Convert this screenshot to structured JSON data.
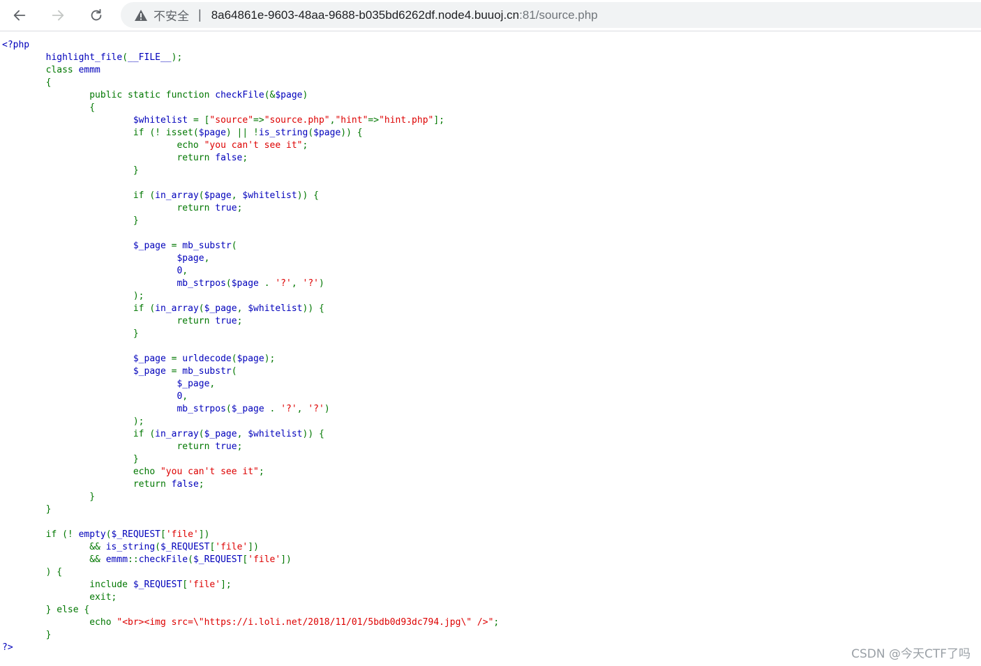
{
  "browser": {
    "insecure_label": "不安全",
    "separator": "|",
    "url_host": "8a64861e-9603-48aa-9688-b035bd6262df.node4.buuoj.cn",
    "url_rest": ":81/source.php"
  },
  "watermark": "CSDN @今天CTF了吗",
  "code_lines": [
    [
      [
        "d",
        "<?php"
      ]
    ],
    [
      [
        "d",
        "        highlight_file"
      ],
      [
        "k",
        "("
      ],
      [
        "d",
        "__FILE__"
      ],
      [
        "k",
        ");"
      ]
    ],
    [
      [
        "k",
        "        class "
      ],
      [
        "d",
        "emmm"
      ]
    ],
    [
      [
        "k",
        "        {"
      ]
    ],
    [
      [
        "k",
        "                public static function "
      ],
      [
        "d",
        "checkFile"
      ],
      [
        "k",
        "(&"
      ],
      [
        "d",
        "$page"
      ],
      [
        "k",
        ")"
      ]
    ],
    [
      [
        "k",
        "                {"
      ]
    ],
    [
      [
        "d",
        "                        $whitelist "
      ],
      [
        "k",
        "= ["
      ],
      [
        "s",
        "\"source\""
      ],
      [
        "k",
        "=>"
      ],
      [
        "s",
        "\"source.php\""
      ],
      [
        "k",
        ","
      ],
      [
        "s",
        "\"hint\""
      ],
      [
        "k",
        "=>"
      ],
      [
        "s",
        "\"hint.php\""
      ],
      [
        "k",
        "];"
      ]
    ],
    [
      [
        "k",
        "                        if (! isset("
      ],
      [
        "d",
        "$page"
      ],
      [
        "k",
        ") || !"
      ],
      [
        "d",
        "is_string"
      ],
      [
        "k",
        "("
      ],
      [
        "d",
        "$page"
      ],
      [
        "k",
        ")) {"
      ]
    ],
    [
      [
        "k",
        "                                echo "
      ],
      [
        "s",
        "\"you can't see it\""
      ],
      [
        "k",
        ";"
      ]
    ],
    [
      [
        "k",
        "                                return "
      ],
      [
        "d",
        "false"
      ],
      [
        "k",
        ";"
      ]
    ],
    [
      [
        "k",
        "                        }"
      ]
    ],
    [
      [
        "d",
        ""
      ]
    ],
    [
      [
        "k",
        "                        if ("
      ],
      [
        "d",
        "in_array"
      ],
      [
        "k",
        "("
      ],
      [
        "d",
        "$page"
      ],
      [
        "k",
        ", "
      ],
      [
        "d",
        "$whitelist"
      ],
      [
        "k",
        ")) {"
      ]
    ],
    [
      [
        "k",
        "                                return "
      ],
      [
        "d",
        "true"
      ],
      [
        "k",
        ";"
      ]
    ],
    [
      [
        "k",
        "                        }"
      ]
    ],
    [
      [
        "d",
        ""
      ]
    ],
    [
      [
        "d",
        "                        $_page "
      ],
      [
        "k",
        "= "
      ],
      [
        "d",
        "mb_substr"
      ],
      [
        "k",
        "("
      ]
    ],
    [
      [
        "d",
        "                                $page"
      ],
      [
        "k",
        ","
      ]
    ],
    [
      [
        "d",
        "                                0"
      ],
      [
        "k",
        ","
      ]
    ],
    [
      [
        "d",
        "                                mb_strpos"
      ],
      [
        "k",
        "("
      ],
      [
        "d",
        "$page "
      ],
      [
        "k",
        ". "
      ],
      [
        "s",
        "'?'"
      ],
      [
        "k",
        ", "
      ],
      [
        "s",
        "'?'"
      ],
      [
        "k",
        ")"
      ]
    ],
    [
      [
        "k",
        "                        );"
      ]
    ],
    [
      [
        "k",
        "                        if ("
      ],
      [
        "d",
        "in_array"
      ],
      [
        "k",
        "("
      ],
      [
        "d",
        "$_page"
      ],
      [
        "k",
        ", "
      ],
      [
        "d",
        "$whitelist"
      ],
      [
        "k",
        ")) {"
      ]
    ],
    [
      [
        "k",
        "                                return "
      ],
      [
        "d",
        "true"
      ],
      [
        "k",
        ";"
      ]
    ],
    [
      [
        "k",
        "                        }"
      ]
    ],
    [
      [
        "d",
        ""
      ]
    ],
    [
      [
        "d",
        "                        $_page "
      ],
      [
        "k",
        "= "
      ],
      [
        "d",
        "urldecode"
      ],
      [
        "k",
        "("
      ],
      [
        "d",
        "$page"
      ],
      [
        "k",
        ");"
      ]
    ],
    [
      [
        "d",
        "                        $_page "
      ],
      [
        "k",
        "= "
      ],
      [
        "d",
        "mb_substr"
      ],
      [
        "k",
        "("
      ]
    ],
    [
      [
        "d",
        "                                $_page"
      ],
      [
        "k",
        ","
      ]
    ],
    [
      [
        "d",
        "                                0"
      ],
      [
        "k",
        ","
      ]
    ],
    [
      [
        "d",
        "                                mb_strpos"
      ],
      [
        "k",
        "("
      ],
      [
        "d",
        "$_page "
      ],
      [
        "k",
        ". "
      ],
      [
        "s",
        "'?'"
      ],
      [
        "k",
        ", "
      ],
      [
        "s",
        "'?'"
      ],
      [
        "k",
        ")"
      ]
    ],
    [
      [
        "k",
        "                        );"
      ]
    ],
    [
      [
        "k",
        "                        if ("
      ],
      [
        "d",
        "in_array"
      ],
      [
        "k",
        "("
      ],
      [
        "d",
        "$_page"
      ],
      [
        "k",
        ", "
      ],
      [
        "d",
        "$whitelist"
      ],
      [
        "k",
        ")) {"
      ]
    ],
    [
      [
        "k",
        "                                return "
      ],
      [
        "d",
        "true"
      ],
      [
        "k",
        ";"
      ]
    ],
    [
      [
        "k",
        "                        }"
      ]
    ],
    [
      [
        "k",
        "                        echo "
      ],
      [
        "s",
        "\"you can't see it\""
      ],
      [
        "k",
        ";"
      ]
    ],
    [
      [
        "k",
        "                        return "
      ],
      [
        "d",
        "false"
      ],
      [
        "k",
        ";"
      ]
    ],
    [
      [
        "k",
        "                }"
      ]
    ],
    [
      [
        "k",
        "        }"
      ]
    ],
    [
      [
        "d",
        ""
      ]
    ],
    [
      [
        "k",
        "        if (! "
      ],
      [
        "d",
        "empty"
      ],
      [
        "k",
        "("
      ],
      [
        "d",
        "$_REQUEST"
      ],
      [
        "k",
        "["
      ],
      [
        "s",
        "'file'"
      ],
      [
        "k",
        "])"
      ]
    ],
    [
      [
        "k",
        "                && "
      ],
      [
        "d",
        "is_string"
      ],
      [
        "k",
        "("
      ],
      [
        "d",
        "$_REQUEST"
      ],
      [
        "k",
        "["
      ],
      [
        "s",
        "'file'"
      ],
      [
        "k",
        "])"
      ]
    ],
    [
      [
        "k",
        "                && "
      ],
      [
        "d",
        "emmm"
      ],
      [
        "k",
        "::"
      ],
      [
        "d",
        "checkFile"
      ],
      [
        "k",
        "("
      ],
      [
        "d",
        "$_REQUEST"
      ],
      [
        "k",
        "["
      ],
      [
        "s",
        "'file'"
      ],
      [
        "k",
        "])"
      ]
    ],
    [
      [
        "k",
        "        ) {"
      ]
    ],
    [
      [
        "k",
        "                include "
      ],
      [
        "d",
        "$_REQUEST"
      ],
      [
        "k",
        "["
      ],
      [
        "s",
        "'file'"
      ],
      [
        "k",
        "];"
      ]
    ],
    [
      [
        "k",
        "                exit;"
      ]
    ],
    [
      [
        "k",
        "        } else {"
      ]
    ],
    [
      [
        "k",
        "                echo "
      ],
      [
        "s",
        "\"<br><img src=\\\"https://i.loli.net/2018/11/01/5bdb0d93dc794.jpg\\\" />\""
      ],
      [
        "k",
        ";"
      ]
    ],
    [
      [
        "k",
        "        }"
      ]
    ],
    [
      [
        "d",
        "?>"
      ]
    ]
  ]
}
